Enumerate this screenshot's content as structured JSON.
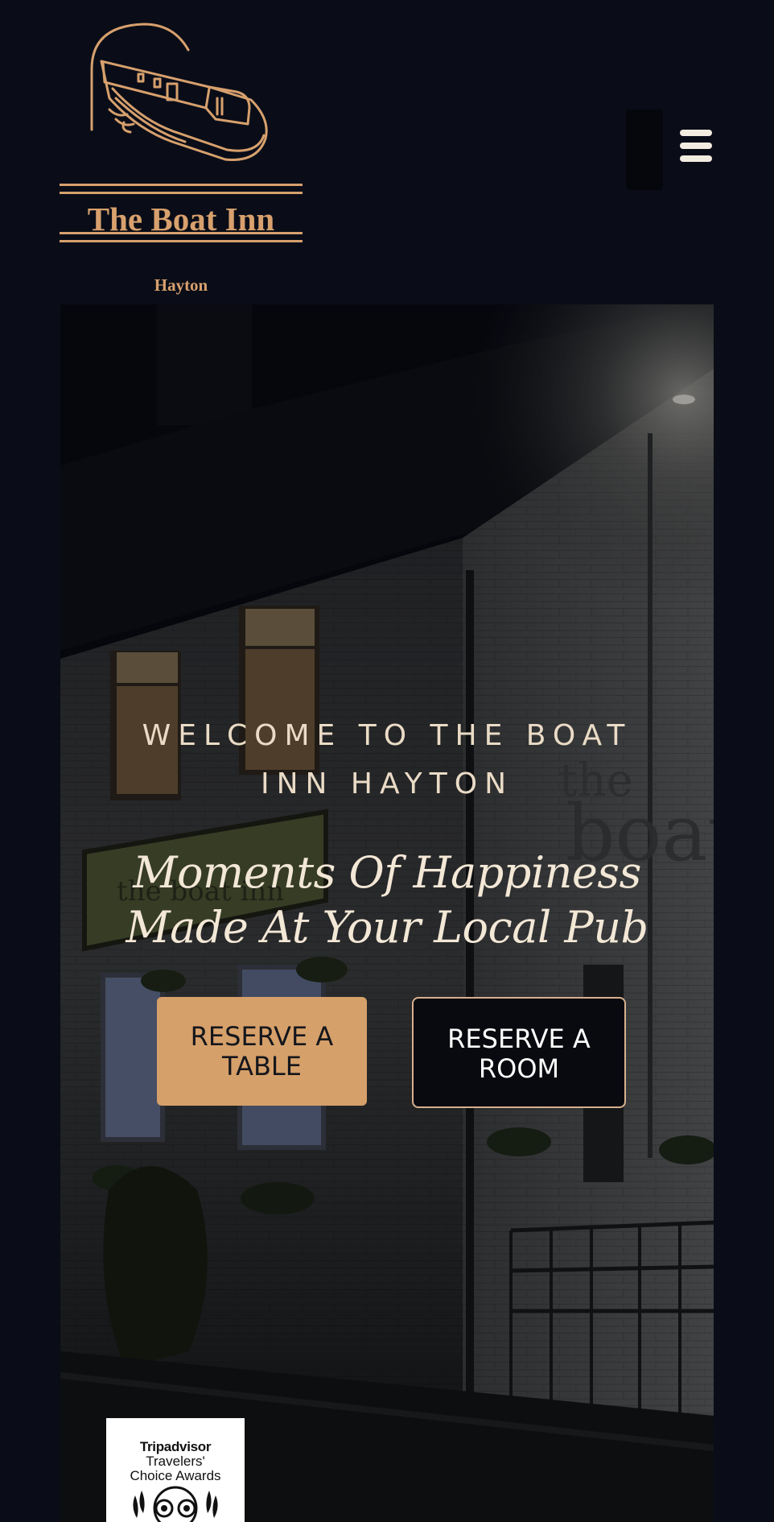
{
  "header": {
    "logo_title": "The Boat Inn",
    "logo_subtitle": "Hayton",
    "menu_icon": "hamburger-menu-icon"
  },
  "hero": {
    "welcome": "WELCOME TO THE BOAT INN HAYTON",
    "tagline": "Moments Of Happiness Made At Your Local Pub",
    "buttons": {
      "reserve_table": "RESERVE A TABLE",
      "reserve_room": "RESERVE A ROOM"
    }
  },
  "badge": {
    "brand": "Tripadvisor",
    "line1": "Travelers'",
    "line2": "Choice Awards",
    "icon": "tripadvisor-owl-icon"
  },
  "colors": {
    "page_background": "#0a0d18",
    "accent": "#d7a06d",
    "button_table": "#d6a06a",
    "button_room": "#090a10"
  }
}
